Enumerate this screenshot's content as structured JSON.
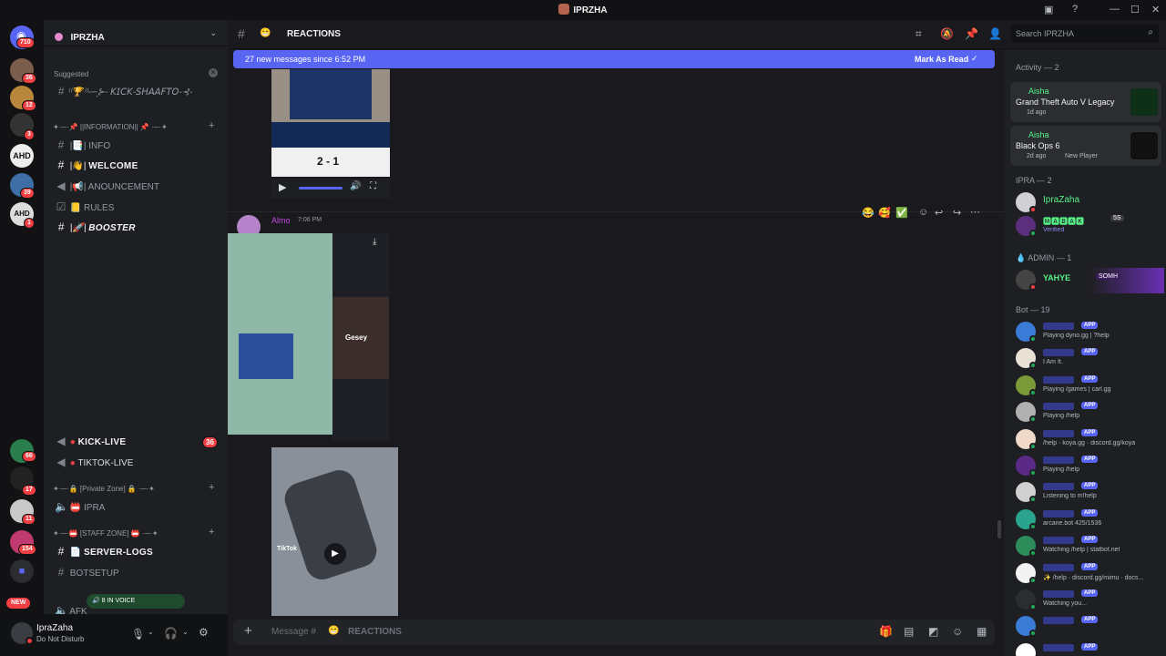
{
  "window": {
    "title": "IPRZHA"
  },
  "servers": {
    "top_badge": "710",
    "badges": [
      "36",
      "12",
      "3",
      "39",
      "1",
      "66",
      "17",
      "11",
      "154"
    ],
    "new_label": "NEW",
    "ahd_label": "AHD"
  },
  "sidebar": {
    "server_name": "IPRZHA",
    "suggested_label": "Suggested",
    "suggested_channel": "⁽⁽🏆⁾⁾-─͙⊱- 𝘒𝘐𝘊𝘒-𝘚𝘏𝘈𝘈𝘍𝘛𝘖-⊰-",
    "info_category": "✦·─·📌 ||INFORMATION|| 📌 ·─·✦",
    "channels": [
      {
        "label": "INFO",
        "prefix": "|📑|"
      },
      {
        "label": "WELCOME",
        "prefix": "|👋|"
      },
      {
        "label": "ANOUNCEMENT",
        "prefix": "|📢|"
      },
      {
        "label": "RULES",
        "prefix": "📒"
      },
      {
        "label": "BOOSTER",
        "prefix": "|🚀|"
      }
    ],
    "live_channels": [
      {
        "label": "KICK-LIVE",
        "badge": "36"
      },
      {
        "label": "TIKTOK-LIVE"
      }
    ],
    "private_category": "✦·─·🔒 [Private Zone] 🔒 ·─·✦",
    "ipra_channel": "IPRA",
    "staff_category": "✦·─·📛 [STAFF ZONE] 📛 ·─·✦",
    "serverlogs": "SERVER-LOGS",
    "botsetup": "BOTSETUP",
    "voice_pill": "8 IN VOICE",
    "afk": "AFK"
  },
  "user": {
    "name": "IpraZaha",
    "status": "Do Not Disturb"
  },
  "header": {
    "channel": "REACTIONS",
    "channel_emoji": "😁",
    "search_placeholder": "Search IPRZHA"
  },
  "banner": {
    "text": "27 new messages since 6:52 PM",
    "action": "Mark As Read"
  },
  "messages": {
    "video1_score": "2 - 1",
    "author": "Almo",
    "time": "7:06 PM",
    "video2_caption": "Gesey",
    "tiktok_label": "TikTok",
    "reactions": [
      "😂",
      "🥰",
      "✅"
    ]
  },
  "input": {
    "placeholder": "Message #",
    "channel": "REACTIONS"
  },
  "members": {
    "activity_header": "Activity — 2",
    "activity": [
      {
        "name": "Aisha",
        "game": "Grand Theft Auto V Legacy",
        "time": "1d ago",
        "extra": ""
      },
      {
        "name": "Aisha",
        "game": "Black Ops 6",
        "time": "2d ago",
        "extra": "New Player"
      }
    ],
    "ipra_header": "IPRA — 2",
    "ipra_members": [
      {
        "name": "IpraZaha",
        "status": ""
      },
      {
        "name": "🅼🅰🅱🅰🅺",
        "status": "Verified",
        "tag": "5S"
      }
    ],
    "admin_header": "ADMIN — 1",
    "admin_members": [
      {
        "name": "YAHYE",
        "tag": "SOMH"
      }
    ],
    "bot_header": "Bot — 19",
    "app_label": "APP",
    "bots": [
      {
        "status": "Playing dyno.gg | ?help"
      },
      {
        "status": "I Am It."
      },
      {
        "status": "Playing /games | carl.gg"
      },
      {
        "status": "Playing /help"
      },
      {
        "status": "/help · koya.gg · discord.gg/koya"
      },
      {
        "status": "Playing /help"
      },
      {
        "status": "Listening to m!help"
      },
      {
        "status": "arcane.bot 425/1536"
      },
      {
        "status": "Watching /help | statbot.net"
      },
      {
        "status": "✨ /help · discord.gg/mimu · docs..."
      },
      {
        "status": "Watching you..."
      },
      {
        "status": ""
      },
      {
        "status": ""
      }
    ]
  },
  "colors": {
    "accent": "#5865f2",
    "dnd": "#f23f43",
    "online": "#23a55a",
    "activity_name": "#57f287"
  }
}
